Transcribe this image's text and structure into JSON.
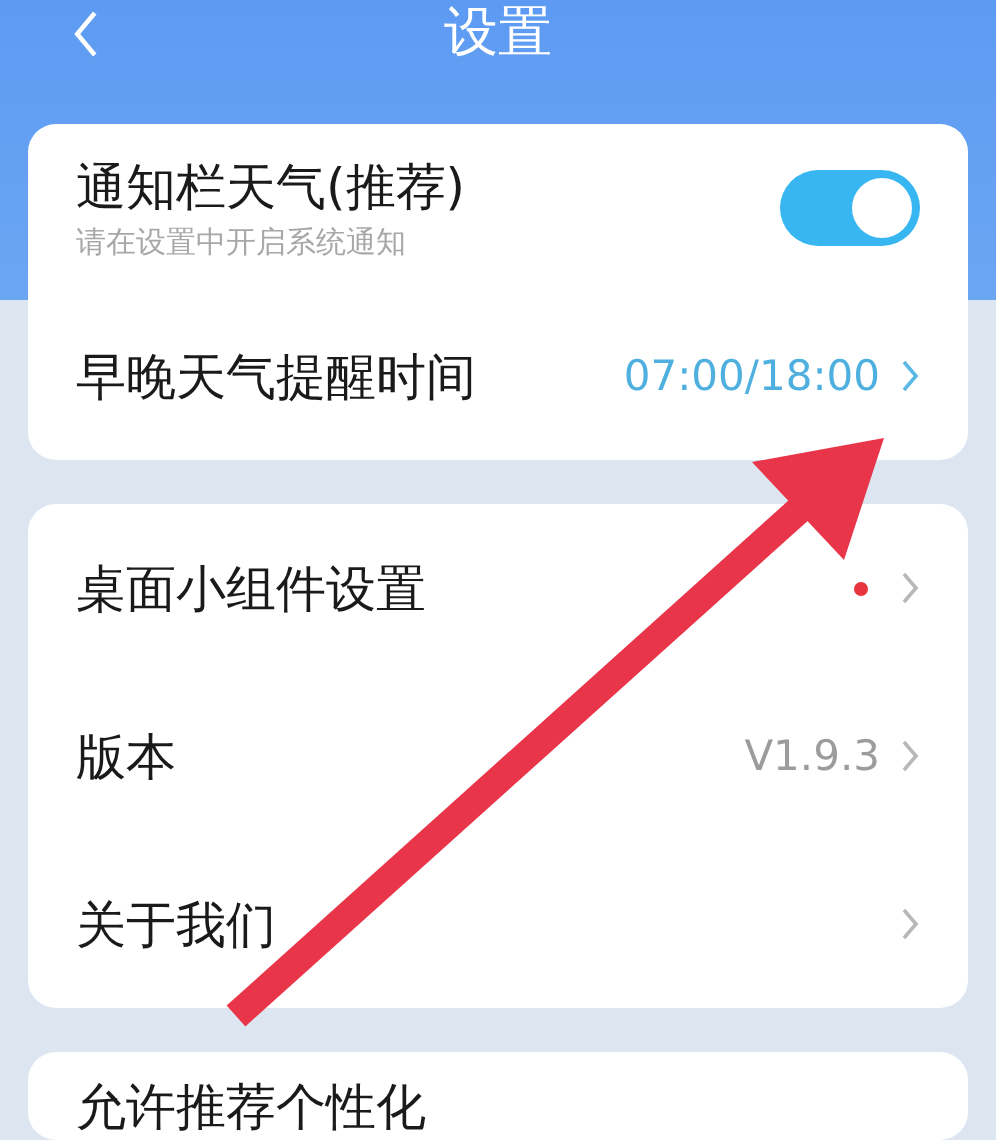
{
  "header": {
    "title": "设置"
  },
  "groups": [
    {
      "rows": [
        {
          "kind": "toggle",
          "label": "通知栏天气(推荐)",
          "hint": "请在设置中开启系统通知",
          "on": true
        },
        {
          "kind": "value",
          "label": "早晚天气提醒时间",
          "value": "07:00/18:00"
        }
      ]
    },
    {
      "rows": [
        {
          "kind": "dot",
          "label": "桌面小组件设置",
          "color": "#e8343f"
        },
        {
          "kind": "gray",
          "label": "版本",
          "value": "V1.9.3"
        },
        {
          "kind": "plain",
          "label": "关于我们"
        }
      ]
    },
    {
      "rows": [
        {
          "kind": "last",
          "label": "允许推荐个性化"
        }
      ]
    }
  ]
}
